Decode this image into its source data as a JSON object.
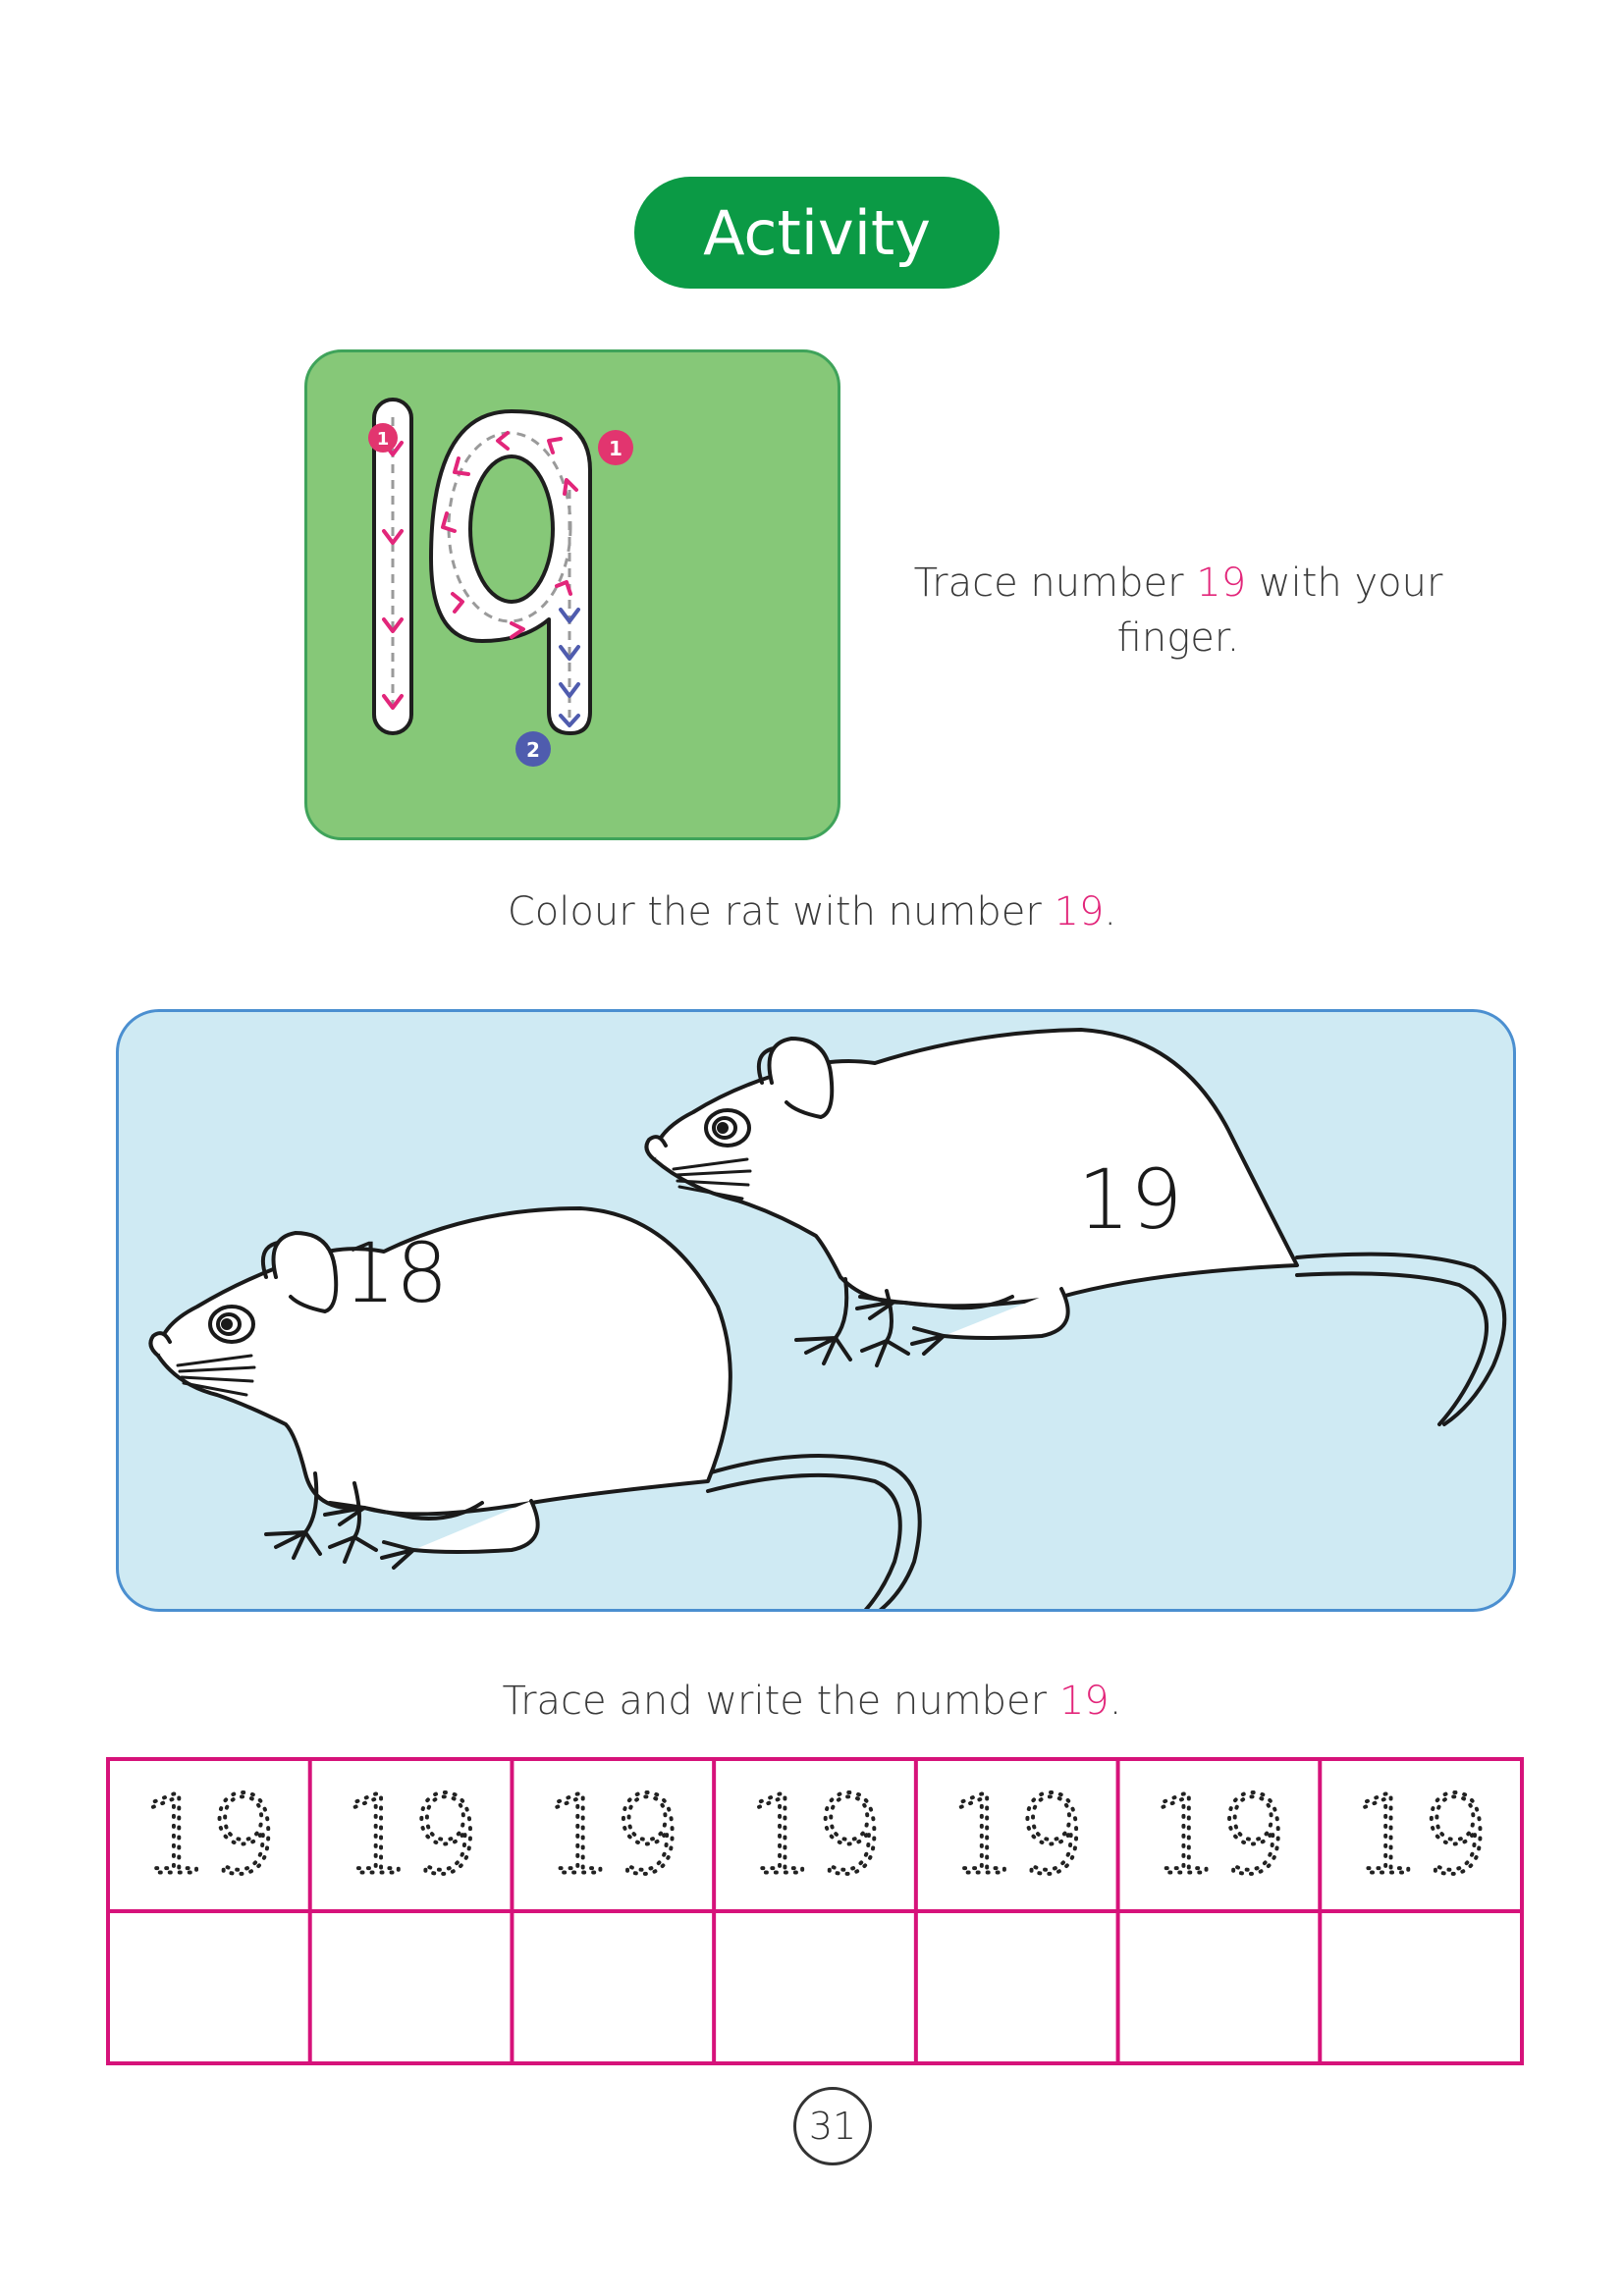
{
  "header": {
    "activity_label": "Activity"
  },
  "trace_card": {
    "digit_one_step": "1",
    "digit_nine_step_one": "1",
    "digit_nine_step_two": "2",
    "colors": {
      "card": "#86c878",
      "arrow_primary": "#e2267a",
      "arrow_secondary": "#4f5cae"
    }
  },
  "instructions": {
    "trace": {
      "before": "Trace number ",
      "number": "19",
      "after": " with your finger."
    },
    "colour": {
      "before": "Colour the rat with number ",
      "number": "19",
      "after": "."
    },
    "write": {
      "before": "Trace and write the number ",
      "number": "19",
      "after": "."
    }
  },
  "rats": [
    {
      "label": "18"
    },
    {
      "label": "19"
    }
  ],
  "trace_grid": {
    "columns": 7,
    "cells": [
      "19",
      "19",
      "19",
      "19",
      "19",
      "19",
      "19"
    ],
    "border_color": "#d6127a"
  },
  "footer": {
    "page_number": "31"
  }
}
